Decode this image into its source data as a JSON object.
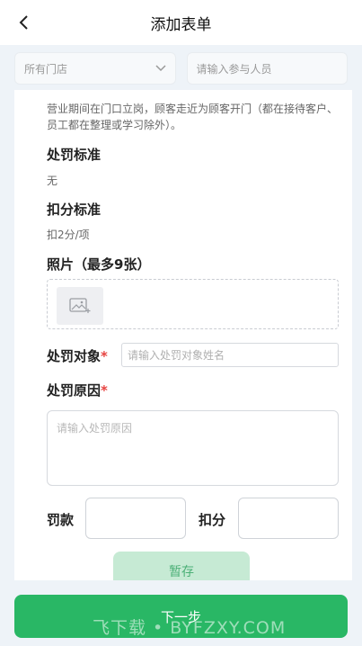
{
  "header": {
    "title": "添加表单"
  },
  "filters": {
    "store_select": "所有门店",
    "participant_placeholder": "请输入参与人员"
  },
  "rule": {
    "description": "营业期间在门口立岗，顾客走近为顾客开门（都在接待客户、员工都在整理或学习除外）。",
    "penalty_standard_label": "处罚标准",
    "penalty_standard_value": "无",
    "deduction_standard_label": "扣分标准",
    "deduction_standard_value": "扣2分/项"
  },
  "photos": {
    "label": "照片（最多9张）"
  },
  "form": {
    "target_label": "处罚对象",
    "target_placeholder": "请输入处罚对象姓名",
    "reason_label": "处罚原因",
    "reason_placeholder": "请输入处罚原因",
    "required_mark": "*",
    "fine_label": "罚款",
    "points_label": "扣分"
  },
  "actions": {
    "save_label": "暂存",
    "next_label": "下一步"
  },
  "watermark": "飞下载 • BYFZXY.COM",
  "colors": {
    "primary": "#29b765",
    "save_bg": "#c6ead4",
    "required": "#e64340"
  },
  "icons": {
    "back": "chevron-left-icon",
    "dropdown": "chevron-down-icon",
    "photo": "image-add-icon"
  }
}
